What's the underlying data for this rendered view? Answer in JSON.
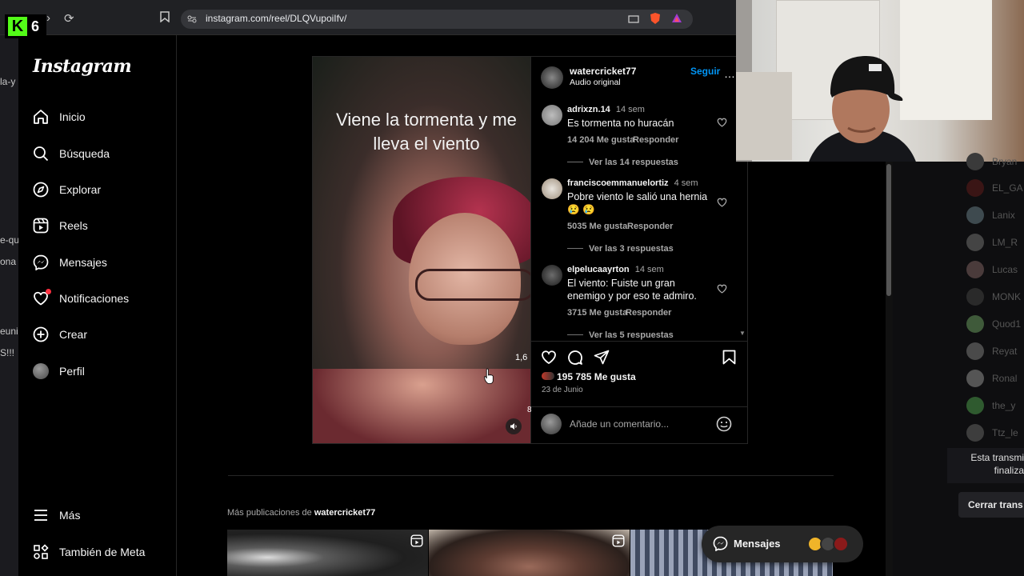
{
  "browser": {
    "url": "instagram.com/reel/DLQVupoiIfv/",
    "kick_badge": "6",
    "kick_letter": "K"
  },
  "left_strip": [
    "la-y",
    "e-qu",
    "ona",
    "euni",
    "S!!!"
  ],
  "sidebar": {
    "logo": "Instagram",
    "items": [
      {
        "label": "Inicio",
        "icon": "home-icon"
      },
      {
        "label": "Búsqueda",
        "icon": "search-icon"
      },
      {
        "label": "Explorar",
        "icon": "compass-icon"
      },
      {
        "label": "Reels",
        "icon": "reels-icon"
      },
      {
        "label": "Mensajes",
        "icon": "messenger-icon"
      },
      {
        "label": "Notificaciones",
        "icon": "heart-icon"
      },
      {
        "label": "Crear",
        "icon": "plus-icon"
      },
      {
        "label": "Perfil",
        "icon": "avatar"
      }
    ],
    "more": "Más",
    "meta": "También de Meta"
  },
  "video": {
    "caption_line1": "Viene la tormenta y me",
    "caption_line2": "lleva el viento",
    "side_count": "1,6",
    "side_count_2": "8"
  },
  "post": {
    "author": "watercricket77",
    "audio": "Audio original",
    "follow": "Seguir",
    "likes": "195 785 Me gusta",
    "date": "23 de Junio",
    "comment_placeholder": "Añade un comentario..."
  },
  "comments": [
    {
      "user": "adrixzn.14",
      "time": "14 sem",
      "text": "Es tormenta no huracán",
      "likes": "14 204 Me gusta",
      "reply": "Responder",
      "replies": "Ver las 14 respuestas"
    },
    {
      "user": "franciscoemmanuelortiz",
      "time": "4 sem",
      "text": "Pobre viento le salió una hernia",
      "emoji": "😢 😢",
      "likes": "5035 Me gusta",
      "reply": "Responder",
      "replies": "Ver las 3 respuestas"
    },
    {
      "user": "elpelucaayrton",
      "time": "14 sem",
      "text": "El viento: Fuiste un gran enemigo y por eso te admiro.",
      "likes": "3715 Me gusta",
      "reply": "Responder",
      "replies": "Ver las 5 respuestas"
    }
  ],
  "more_posts": {
    "prefix": "Más publicaciones de",
    "user": "watercricket77"
  },
  "messages_pill": "Mensajes",
  "chat": {
    "names": [
      "Bryan",
      "EL_GA",
      "Lanix",
      "LM_R",
      "Lucas",
      "MONK",
      "Quod1",
      "Reyat",
      "Ronal",
      "the_y",
      "Ttz_le"
    ],
    "stream_ended_line1": "Esta transmi",
    "stream_ended_line2": "finaliza",
    "close": "Cerrar trans"
  },
  "colors": {
    "accent_blue": "#0095f6",
    "notif_red": "#ff3040",
    "kick_green": "#53fc18"
  }
}
